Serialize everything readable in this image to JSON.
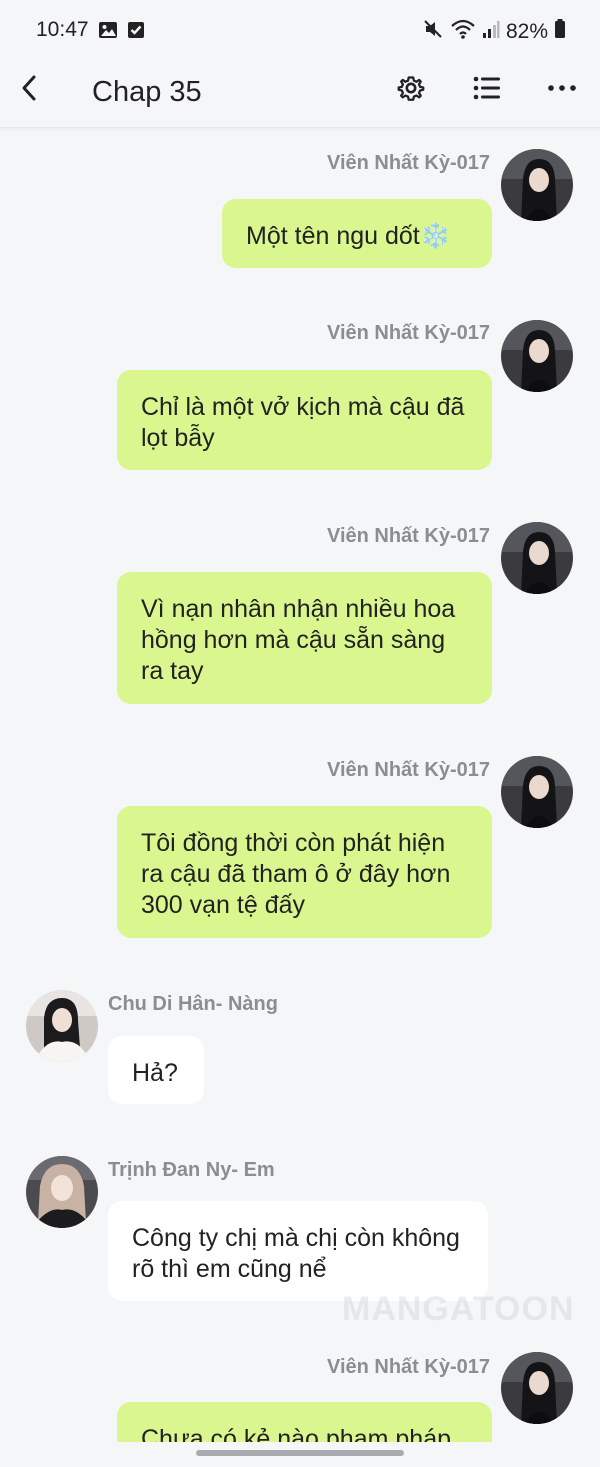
{
  "status_bar": {
    "time": "10:47",
    "battery": "82%",
    "left_icons": [
      "image-icon",
      "checkbox-icon"
    ],
    "right_icons": [
      "mute-icon",
      "wifi-icon",
      "signal-icon",
      "battery-icon"
    ]
  },
  "header": {
    "title": "Chap 35",
    "icons": [
      "back-icon",
      "settings-icon",
      "list-icon",
      "more-icon"
    ]
  },
  "messages": [
    {
      "side": "right",
      "sender": "Viên Nhất Kỳ-017",
      "text": "Một tên ngu dốt❄️"
    },
    {
      "side": "right",
      "sender": "Viên Nhất Kỳ-017",
      "text": "Chỉ là một vở kịch mà cậu đã lọt bẫy"
    },
    {
      "side": "right",
      "sender": "Viên Nhất Kỳ-017",
      "text": "Vì nạn nhân nhận nhiều hoa hồng hơn mà cậu sẵn sàng ra tay"
    },
    {
      "side": "right",
      "sender": "Viên Nhất Kỳ-017",
      "text": "Tôi đồng thời còn phát hiện ra cậu đã tham ô ở đây hơn 300 vạn tệ đấy"
    },
    {
      "side": "left",
      "sender": "Chu Di Hân- Nàng",
      "text": "Hả?"
    },
    {
      "side": "left",
      "sender": "Trịnh Đan Ny- Em",
      "text": "Công ty chị mà chị còn không rõ thì em cũng nể"
    },
    {
      "side": "right",
      "sender": "Viên Nhất Kỳ-017",
      "text": "Chưa có kẻ nào phạm pháp"
    }
  ],
  "watermark": "MANGATOON",
  "colors": {
    "background": "#f5f6f8",
    "bubble_self": "#d9f78e",
    "bubble_other": "#ffffff",
    "name_gray": "#8b8d91"
  }
}
